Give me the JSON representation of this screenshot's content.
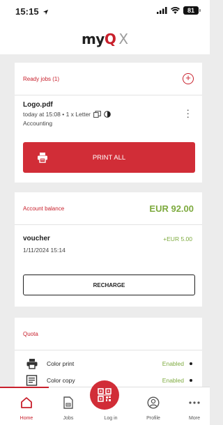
{
  "status_bar": {
    "time": "15:15",
    "battery": "81"
  },
  "header": {
    "logo_main_pre": "my",
    "logo_main_q": "Q",
    "logo_x": "X"
  },
  "ready_jobs": {
    "title": "Ready jobs (1)",
    "jobs": [
      {
        "name": "Logo.pdf",
        "meta": "today at 15:08 • 1 x Letter",
        "department": "Accounting"
      }
    ],
    "print_all_label": "PRINT ALL"
  },
  "account_balance": {
    "title": "Account balance",
    "amount": "EUR 92.00",
    "transactions": [
      {
        "name": "voucher",
        "date": "1/11/2024 15:14",
        "amount": "+EUR 5.00"
      }
    ],
    "recharge_label": "RECHARGE"
  },
  "quota": {
    "title": "Quota",
    "items": [
      {
        "label": "Color print",
        "status": "Enabled",
        "icon": "printer-icon"
      },
      {
        "label": "Color copy",
        "status": "Enabled",
        "icon": "copy-icon"
      }
    ]
  },
  "tabbar": {
    "active": "Home",
    "tabs": [
      {
        "label": "Home",
        "icon": "home-icon"
      },
      {
        "label": "Jobs",
        "icon": "jobs-icon"
      },
      {
        "label": "Log in",
        "icon": "qr-code-icon"
      },
      {
        "label": "Profile",
        "icon": "profile-icon"
      },
      {
        "label": "More",
        "icon": "more-icon"
      }
    ]
  },
  "colors": {
    "accent": "#d12d37",
    "positive": "#7daa3e",
    "background": "#ececec"
  }
}
